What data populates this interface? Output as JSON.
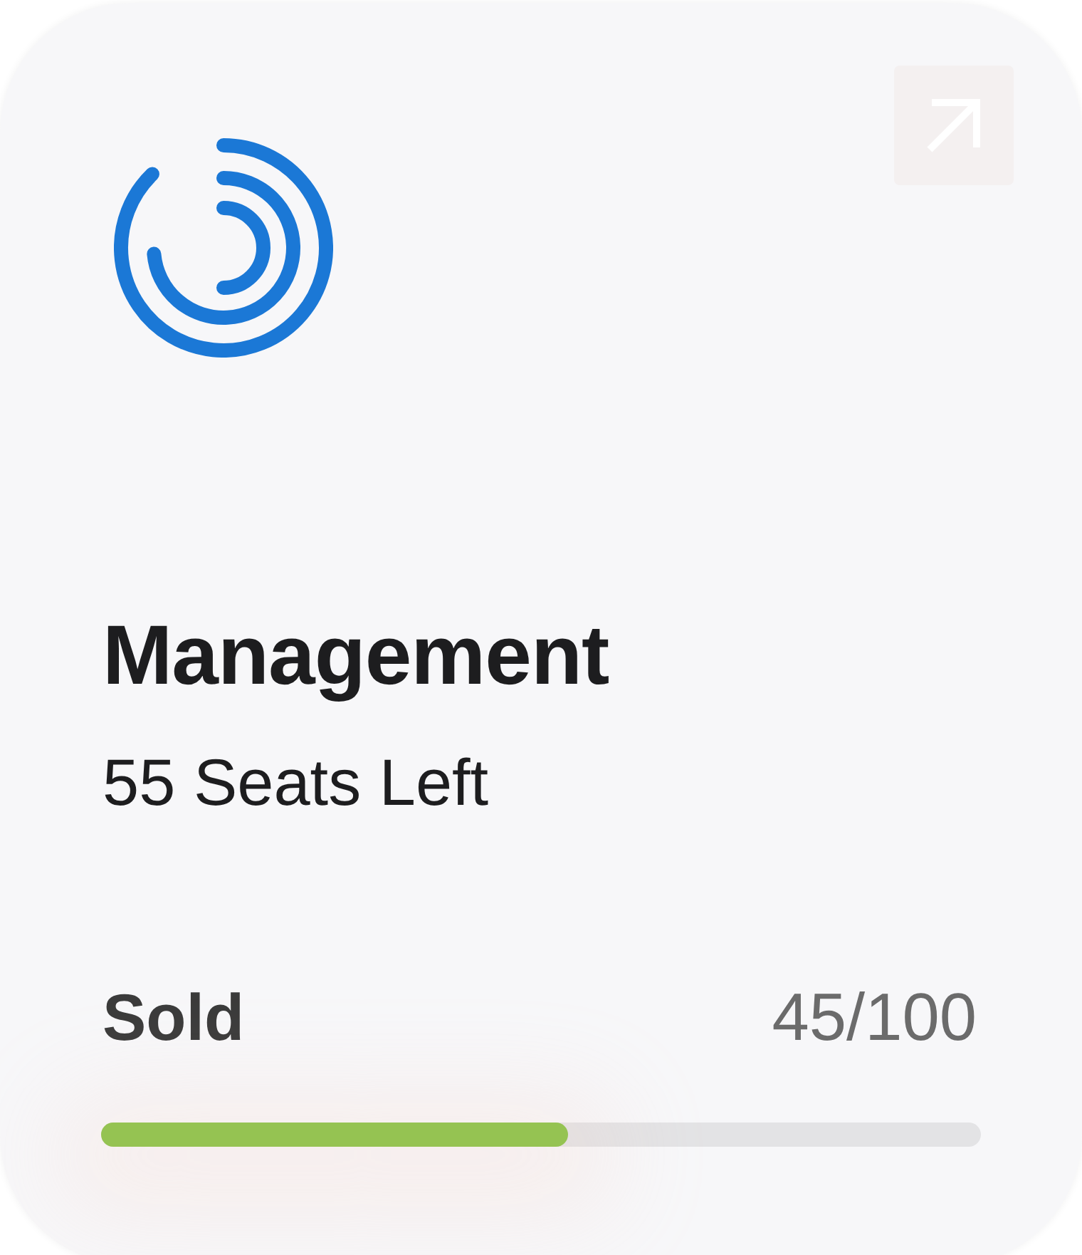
{
  "card": {
    "title": "Management",
    "subtitle": "55 Seats Left",
    "progress": {
      "label": "Sold",
      "reading": "45/100",
      "level": 0.53
    }
  }
}
